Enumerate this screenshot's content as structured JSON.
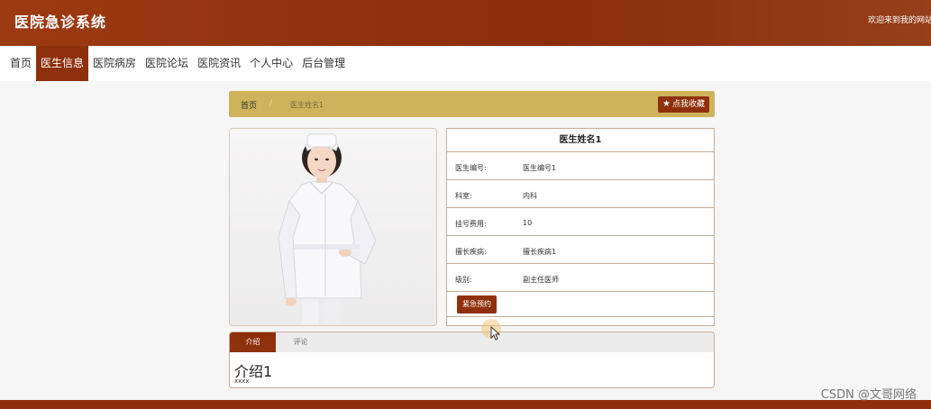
{
  "header": {
    "site_title": "医院急诊系统",
    "welcome_text": "欢迎来到我的网站"
  },
  "nav": {
    "items": [
      {
        "label": "首页",
        "active": false
      },
      {
        "label": "医生信息",
        "active": true
      },
      {
        "label": "医院病房",
        "active": false
      },
      {
        "label": "医院论坛",
        "active": false
      },
      {
        "label": "医院资讯",
        "active": false
      },
      {
        "label": "个人中心",
        "active": false
      },
      {
        "label": "后台管理",
        "active": false
      }
    ]
  },
  "breadcrumb": {
    "home": "首页",
    "separator": "/",
    "current": "医生姓名1"
  },
  "favorite_button": {
    "icon": "star-icon",
    "label": "点我收藏"
  },
  "doctor": {
    "photo_icon": "nurse-photo",
    "name": "医生姓名1",
    "fields": [
      {
        "label": "医生编号:",
        "value": "医生编号1"
      },
      {
        "label": "科室:",
        "value": "内科"
      },
      {
        "label": "挂号费用:",
        "value": "10"
      },
      {
        "label": "擅长疾病:",
        "value": "擅长疾病1"
      },
      {
        "label": "级别:",
        "value": "副主任医师"
      }
    ],
    "reserve_button": "紧急预约"
  },
  "tabs": {
    "items": [
      {
        "label": "介绍",
        "active": true
      },
      {
        "label": "评论",
        "active": false
      }
    ],
    "intro_title": "介绍1",
    "intro_text": "xxxx"
  },
  "watermark": "CSDN @文哥网络",
  "colors": {
    "brand": "#8f300c",
    "breadcrumb_bg": "#cfb35a",
    "border": "#c9ad99"
  }
}
